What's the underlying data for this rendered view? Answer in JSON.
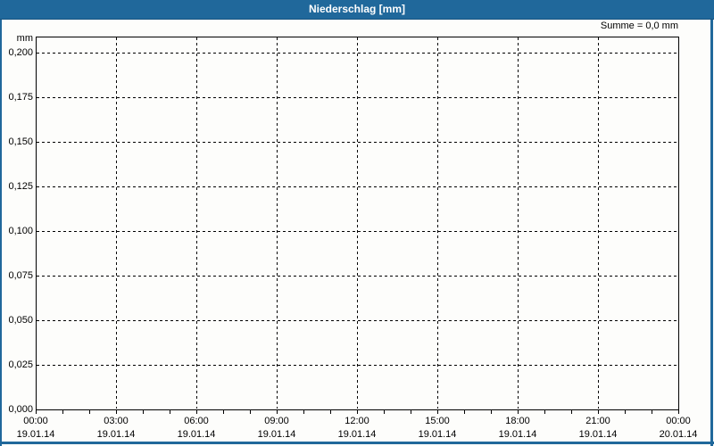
{
  "window": {
    "title": "Niederschlag [mm]"
  },
  "header": {
    "summary_label": "Summe = 0,0 mm"
  },
  "colors": {
    "titlebar_bg": "#20689B",
    "titlebar_text": "#FFFFFF",
    "panel_border": "#20689B",
    "panel_bg": "#FDFDFB",
    "plot_border": "#000000",
    "grid": "#000000",
    "label_text": "#000000"
  },
  "chart_data": {
    "type": "bar",
    "title": "Niederschlag [mm]",
    "ylabel": "mm",
    "xlabel": "",
    "ylim": [
      0,
      0.2
    ],
    "ytick_step": 0.025,
    "ytick_labels_top_to_bottom": [
      "0,200",
      "0,175",
      "0,150",
      "0,125",
      "0,100",
      "0,075",
      "0,050",
      "0,025",
      "0,000"
    ],
    "xtick_labels": [
      {
        "time": "00:00",
        "date": "19.01.14"
      },
      {
        "time": "03:00",
        "date": "19.01.14"
      },
      {
        "time": "06:00",
        "date": "19.01.14"
      },
      {
        "time": "09:00",
        "date": "19.01.14"
      },
      {
        "time": "12:00",
        "date": "19.01.14"
      },
      {
        "time": "15:00",
        "date": "19.01.14"
      },
      {
        "time": "18:00",
        "date": "19.01.14"
      },
      {
        "time": "21:00",
        "date": "19.01.14"
      },
      {
        "time": "00:00",
        "date": "20.01.14"
      }
    ],
    "x_minor_ticks_per_major_interval": 3,
    "grid": "dashed",
    "legend_position": "none",
    "series": [
      {
        "name": "Niederschlag",
        "values": [],
        "sum_label": "Summe = 0,0 mm"
      }
    ]
  }
}
